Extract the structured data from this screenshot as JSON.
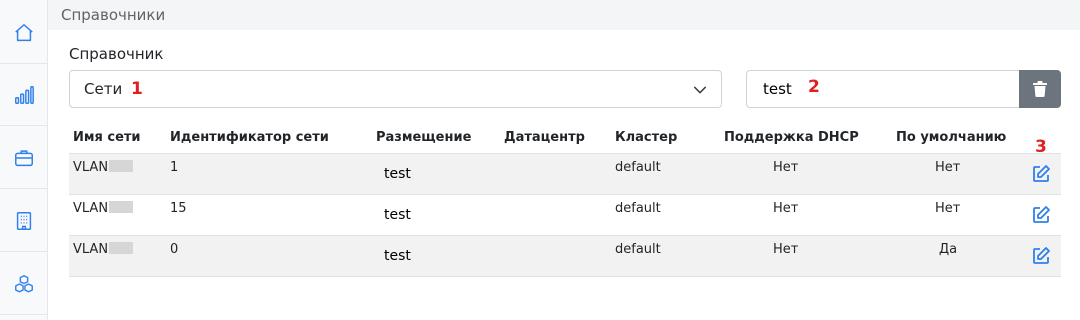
{
  "sidebar": {
    "items": [
      {
        "icon": "home-icon"
      },
      {
        "icon": "bar-chart-icon"
      },
      {
        "icon": "briefcase-icon"
      },
      {
        "icon": "building-icon"
      },
      {
        "icon": "cubes-icon"
      }
    ]
  },
  "header": {
    "title": "Справочники"
  },
  "directory": {
    "label": "Справочник",
    "selected": "Сети",
    "marker": "1"
  },
  "search": {
    "value": "test",
    "marker": "2"
  },
  "table": {
    "marker": "3",
    "columns": [
      "Имя сети",
      "Идентификатор сети",
      "Размещение",
      "Датацентр",
      "Кластер",
      "Поддержка DHCP",
      "По умолчанию"
    ],
    "rows": [
      {
        "name": "VLAN",
        "id": "1",
        "location": "test",
        "datacenter": "",
        "cluster": "default",
        "dhcp": "Нет",
        "default": "Нет"
      },
      {
        "name": "VLAN",
        "id": "15",
        "location": "test",
        "datacenter": "",
        "cluster": "default",
        "dhcp": "Нет",
        "default": "Нет"
      },
      {
        "name": "VLAN",
        "id": "0",
        "location": "test",
        "datacenter": "",
        "cluster": "default",
        "dhcp": "Нет",
        "default": "Да"
      }
    ]
  },
  "colors": {
    "accent": "#2f80ed",
    "marker": "#e02020",
    "clear_button": "#6c757d",
    "stripe": "#f2f2f2"
  }
}
